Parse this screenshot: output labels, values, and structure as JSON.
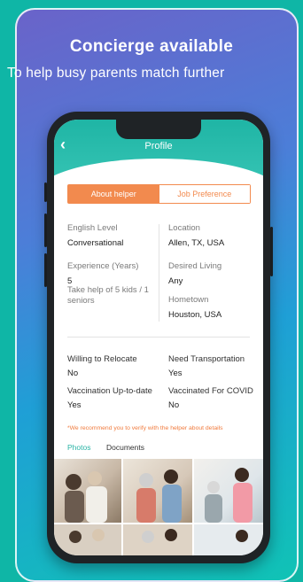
{
  "promo": {
    "headline": "Concierge available",
    "subline": "To help busy parents match further"
  },
  "app": {
    "title": "Profile",
    "back_icon": "chevron-left-icon",
    "tabs": [
      {
        "label": "About helper",
        "active": true
      },
      {
        "label": "Job Preference",
        "active": false
      }
    ],
    "fields": {
      "english_level": {
        "label": "English Level",
        "value": "Conversational"
      },
      "location": {
        "label": "Location",
        "value": "Allen, TX, USA"
      },
      "experience": {
        "label": "Experience (Years)",
        "value": "5",
        "detail": "Take help of 5 kids / 1 seniors"
      },
      "desired_living": {
        "label": "Desired Living",
        "value": "Any"
      },
      "hometown": {
        "label": "Hometown",
        "value": "Houston, USA"
      },
      "relocate": {
        "label": "Willing to Relocate",
        "value": "No"
      },
      "transportation": {
        "label": "Need Transportation",
        "value": "Yes"
      },
      "vaccination": {
        "label": "Vaccination Up-to-date",
        "value": "Yes"
      },
      "covid": {
        "label": "Vaccinated For COVID",
        "value": "No"
      }
    },
    "note": "*We recommend you to verify with the helper about details",
    "media_tabs": {
      "photos": "Photos",
      "documents": "Documents"
    },
    "colors": {
      "teal": "#1fb5a5",
      "orange": "#f28a4e"
    }
  }
}
